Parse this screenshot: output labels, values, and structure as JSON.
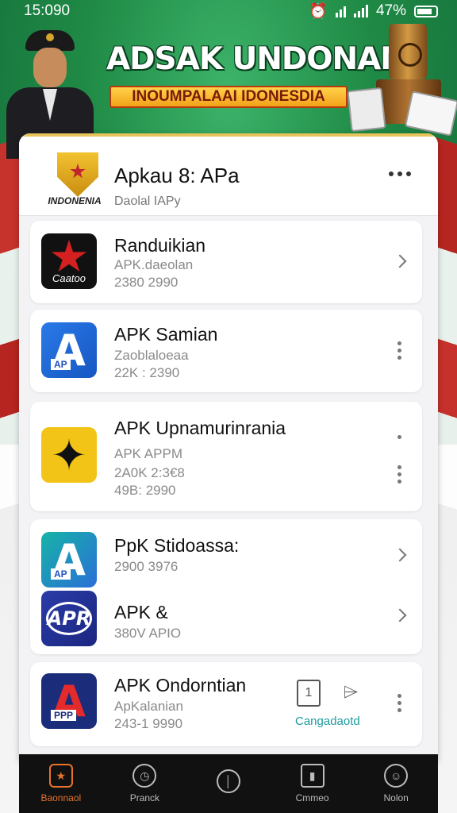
{
  "status_bar": {
    "time": "15:090",
    "battery_text": "47%"
  },
  "hero": {
    "title": "ADSAK UNDONAN",
    "subtitle": "INOUMPALAAI IDONESDIA"
  },
  "header": {
    "emblem_text": "INDONENIA",
    "title": "Apkau 8: APa",
    "subtitle": "Daolal IAPy"
  },
  "apps": [
    {
      "title": "Randuikian",
      "line1": "APK.daeolan",
      "line2": "2380 2990",
      "icon_label": "Caatoo"
    },
    {
      "title": "APK Samian",
      "line1": "Zaoblaloeaa",
      "line2": "22K : 2390",
      "icon_letter": "A",
      "icon_tag": "AP"
    },
    {
      "title": "APK Upnamurinrania",
      "line1": "APK APPM",
      "line2": "2A0K 2:3€8",
      "line3": "49B: 2990"
    },
    {
      "title": "PpK Stidoassa:",
      "line1": "2900 3976",
      "icon_letter": "A",
      "icon_tag": "AP"
    },
    {
      "title": "APK &",
      "line1": "380V APIO",
      "icon_letter": "APR"
    },
    {
      "title": "APK Ondorntian",
      "line1": "ApKalanian",
      "line2": "243-1 9990",
      "icon_letter": "A",
      "icon_tag": "PPP",
      "action_text": "Cangadaotd"
    }
  ],
  "bottom_nav": [
    {
      "label": "Baonnaol",
      "icon": "star-icon",
      "active": true
    },
    {
      "label": "Pranck",
      "icon": "clock-icon"
    },
    {
      "label": "",
      "icon": "gauge-icon"
    },
    {
      "label": "Cmmeo",
      "icon": "chart-icon"
    },
    {
      "label": "Nolon",
      "icon": "user-icon"
    }
  ],
  "colors": {
    "accent": "#e8742c",
    "hero_green": "#1f8a45",
    "link": "#1f9aa0"
  }
}
